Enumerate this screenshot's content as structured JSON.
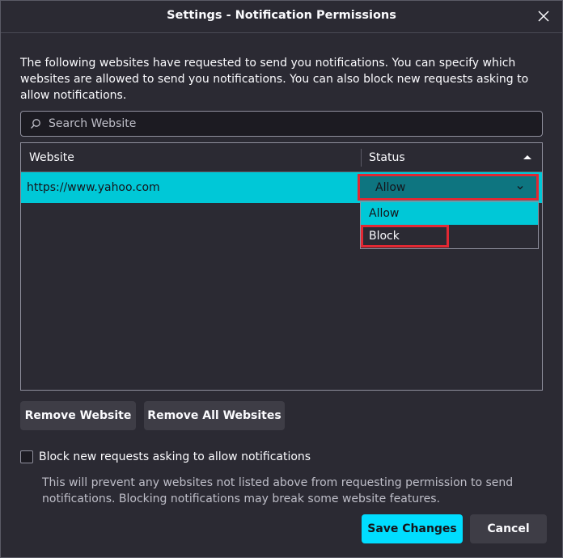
{
  "dialog": {
    "title": "Settings - Notification Permissions",
    "description": "The following websites have requested to send you notifications. You can specify which websites are allowed to send you notifications. You can also block new requests asking to allow notifications."
  },
  "search": {
    "placeholder": "Search Website",
    "value": ""
  },
  "table": {
    "columns": [
      "Website",
      "Status"
    ],
    "rows": [
      {
        "website": "https://www.yahoo.com",
        "status": "Allow"
      }
    ]
  },
  "status_dropdown": {
    "selected": "Allow",
    "options": [
      "Allow",
      "Block"
    ]
  },
  "buttons": {
    "remove_website": "Remove Website",
    "remove_all_websites": "Remove All Websites",
    "save_changes": "Save Changes",
    "cancel": "Cancel"
  },
  "block_new": {
    "label": "Block new requests asking to allow notifications",
    "checked": false,
    "note": "This will prevent any websites not listed above from requesting permission to send notifications. Blocking notifications may break some website features."
  },
  "colors": {
    "accent": "#00ddff",
    "row_selected": "#00c8d7",
    "select_bg": "#0e7580",
    "highlight": "#e22833",
    "background": "#2b2a33"
  },
  "icons": [
    "close-icon",
    "search-icon",
    "sort-ascending-icon",
    "chevron-down-icon"
  ]
}
